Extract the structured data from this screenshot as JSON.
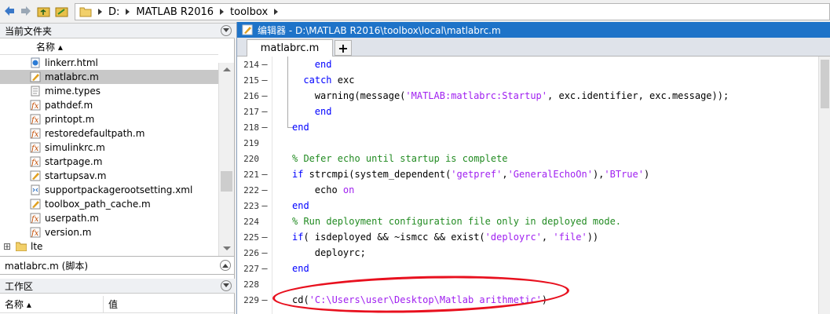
{
  "toolbar": {
    "icons": [
      "back-arrow-icon",
      "forward-arrow-icon",
      "up-folder-icon",
      "browse-folder-icon"
    ],
    "breadcrumb": [
      "D:",
      "MATLAB R2016",
      "toolbox"
    ]
  },
  "current_folder": {
    "title": "当前文件夹",
    "column_name": "名称 ▴",
    "files": [
      {
        "name": "linkerr.html",
        "icon": "html-file-icon",
        "selected": false
      },
      {
        "name": "matlabrc.m",
        "icon": "m-script-icon",
        "selected": true
      },
      {
        "name": "mime.types",
        "icon": "text-file-icon",
        "selected": false
      },
      {
        "name": "pathdef.m",
        "icon": "m-function-icon",
        "selected": false
      },
      {
        "name": "printopt.m",
        "icon": "m-function-icon",
        "selected": false
      },
      {
        "name": "restoredefaultpath.m",
        "icon": "m-function-icon",
        "selected": false
      },
      {
        "name": "simulinkrc.m",
        "icon": "m-function-icon",
        "selected": false
      },
      {
        "name": "startpage.m",
        "icon": "m-function-icon",
        "selected": false
      },
      {
        "name": "startupsav.m",
        "icon": "m-script-icon",
        "selected": false
      },
      {
        "name": "supportpackagerootsetting.xml",
        "icon": "xml-file-icon",
        "selected": false
      },
      {
        "name": "toolbox_path_cache.m",
        "icon": "m-script-icon",
        "selected": false
      },
      {
        "name": "userpath.m",
        "icon": "m-function-icon",
        "selected": false
      },
      {
        "name": "version.m",
        "icon": "m-function-icon",
        "selected": false
      }
    ],
    "folder": {
      "name": "lte",
      "expander": "⊞"
    }
  },
  "details": {
    "label": "matlabrc.m  (脚本)"
  },
  "workspace": {
    "title": "工作区",
    "col_name": "名称 ▴",
    "col_value": "值"
  },
  "editor": {
    "title": "编辑器 - D:\\MATLAB R2016\\toolbox\\local\\matlabrc.m",
    "tab_label": "matlabrc.m",
    "add_tab": "+",
    "lines": [
      {
        "num": "214",
        "dash": "–",
        "indent": 4,
        "tokens": [
          {
            "t": "end",
            "c": "kw"
          }
        ]
      },
      {
        "num": "215",
        "dash": "–",
        "indent": 2,
        "tokens": [
          {
            "t": "catch",
            "c": "kw"
          },
          {
            "t": " exc",
            "c": ""
          }
        ]
      },
      {
        "num": "216",
        "dash": "–",
        "indent": 4,
        "tokens": [
          {
            "t": "warning(message(",
            "c": ""
          },
          {
            "t": "'MATLAB:matlabrc:Startup'",
            "c": "str"
          },
          {
            "t": ", exc.identifier, exc.message));",
            "c": ""
          }
        ]
      },
      {
        "num": "217",
        "dash": "–",
        "indent": 4,
        "tokens": [
          {
            "t": "end",
            "c": "kw"
          }
        ]
      },
      {
        "num": "218",
        "dash": "–",
        "indent": 0,
        "tokens": [
          {
            "t": "end",
            "c": "kw"
          }
        ]
      },
      {
        "num": "219",
        "dash": "",
        "indent": 0,
        "tokens": []
      },
      {
        "num": "220",
        "dash": "",
        "indent": 0,
        "tokens": [
          {
            "t": "% Defer echo until startup is complete",
            "c": "cmt"
          }
        ]
      },
      {
        "num": "221",
        "dash": "–",
        "indent": 0,
        "tokens": [
          {
            "t": "if",
            "c": "kw"
          },
          {
            "t": " strcmpi(system_dependent(",
            "c": ""
          },
          {
            "t": "'getpref'",
            "c": "str"
          },
          {
            "t": ",",
            "c": ""
          },
          {
            "t": "'GeneralEchoOn'",
            "c": "str"
          },
          {
            "t": "),",
            "c": ""
          },
          {
            "t": "'BTrue'",
            "c": "str"
          },
          {
            "t": ")",
            "c": ""
          }
        ]
      },
      {
        "num": "222",
        "dash": "–",
        "indent": 4,
        "tokens": [
          {
            "t": "echo ",
            "c": ""
          },
          {
            "t": "on",
            "c": "str"
          }
        ]
      },
      {
        "num": "223",
        "dash": "–",
        "indent": 0,
        "tokens": [
          {
            "t": "end",
            "c": "kw"
          }
        ]
      },
      {
        "num": "224",
        "dash": "",
        "indent": 0,
        "tokens": [
          {
            "t": "% Run deployment configuration file only in deployed mode.",
            "c": "cmt"
          }
        ]
      },
      {
        "num": "225",
        "dash": "–",
        "indent": 0,
        "tokens": [
          {
            "t": "if",
            "c": "kw"
          },
          {
            "t": "( isdeployed && ~ismcc && exist(",
            "c": ""
          },
          {
            "t": "'deployrc'",
            "c": "str"
          },
          {
            "t": ", ",
            "c": ""
          },
          {
            "t": "'file'",
            "c": "str"
          },
          {
            "t": "))",
            "c": ""
          }
        ]
      },
      {
        "num": "226",
        "dash": "–",
        "indent": 4,
        "tokens": [
          {
            "t": "deployrc;",
            "c": ""
          }
        ]
      },
      {
        "num": "227",
        "dash": "–",
        "indent": 0,
        "tokens": [
          {
            "t": "end",
            "c": "kw"
          }
        ]
      },
      {
        "num": "228",
        "dash": "",
        "indent": 0,
        "tokens": []
      },
      {
        "num": "229",
        "dash": "–",
        "indent": 0,
        "tokens": [
          {
            "t": "cd(",
            "c": ""
          },
          {
            "t": "'C:\\Users\\user\\Desktop\\Matlab arithmetic'",
            "c": "str"
          },
          {
            "t": ")",
            "c": ""
          }
        ]
      }
    ]
  },
  "annotation": {
    "color": "#e8101e"
  },
  "colors": {
    "title_bar": "#1e73c8",
    "keyword": "#0000ff",
    "string": "#a020f0",
    "comment": "#228b22"
  }
}
